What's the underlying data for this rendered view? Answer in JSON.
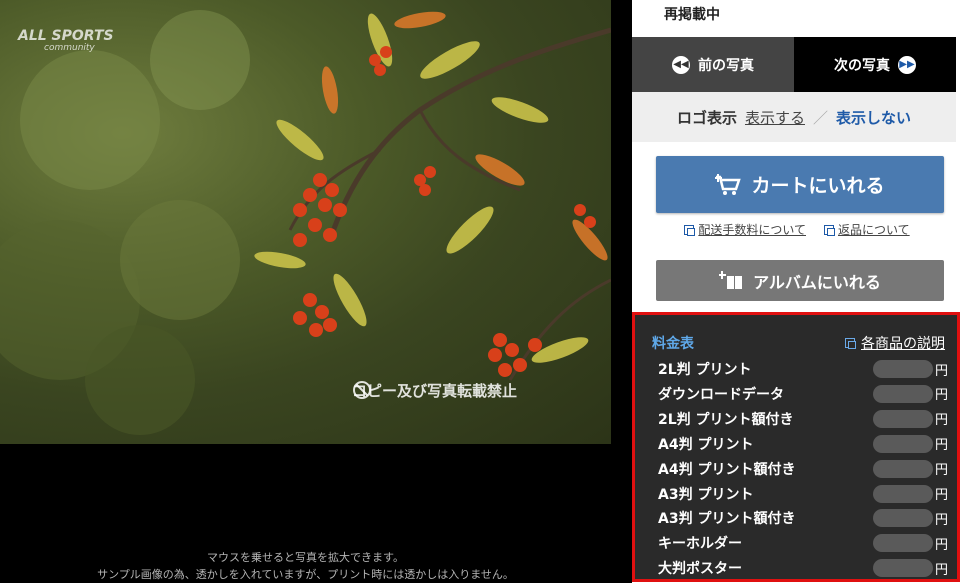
{
  "photo": {
    "watermark_logo": "ALL SPORTS",
    "watermark_logo_sub": "community",
    "no_copy_text": "コピー及び写真転載禁止"
  },
  "hints": {
    "line1": "マウスを乗せると写真を拡大できます。",
    "line2": "サンプル画像の為、透かしを入れていますが、プリント時には透かしは入りません。"
  },
  "panel": {
    "republish": "再掲載中",
    "prev_label": "前の写真",
    "next_label": "次の写真",
    "logo_label": "ロゴ表示",
    "logo_show": "表示する",
    "logo_sep": "／",
    "logo_hide": "表示しない",
    "cart_label": "カートにいれる",
    "shipping_link": "配送手数料について",
    "return_link": "返品について",
    "album_label": "アルバムにいれる"
  },
  "prices": {
    "title": "料金表",
    "desc_link": "各商品の説明",
    "unit": "円",
    "items": [
      {
        "name": "2L判 プリント"
      },
      {
        "name": "ダウンロードデータ"
      },
      {
        "name": "2L判 プリント額付き"
      },
      {
        "name": "A4判 プリント"
      },
      {
        "name": "A4判 プリント額付き"
      },
      {
        "name": "A3判 プリント"
      },
      {
        "name": "A3判 プリント額付き"
      },
      {
        "name": "キーホルダー"
      },
      {
        "name": "大判ポスター"
      }
    ]
  },
  "colors": {
    "accent_blue": "#4a7ab0",
    "link_blue": "#1e5aa8",
    "highlight_red": "#e01010"
  }
}
